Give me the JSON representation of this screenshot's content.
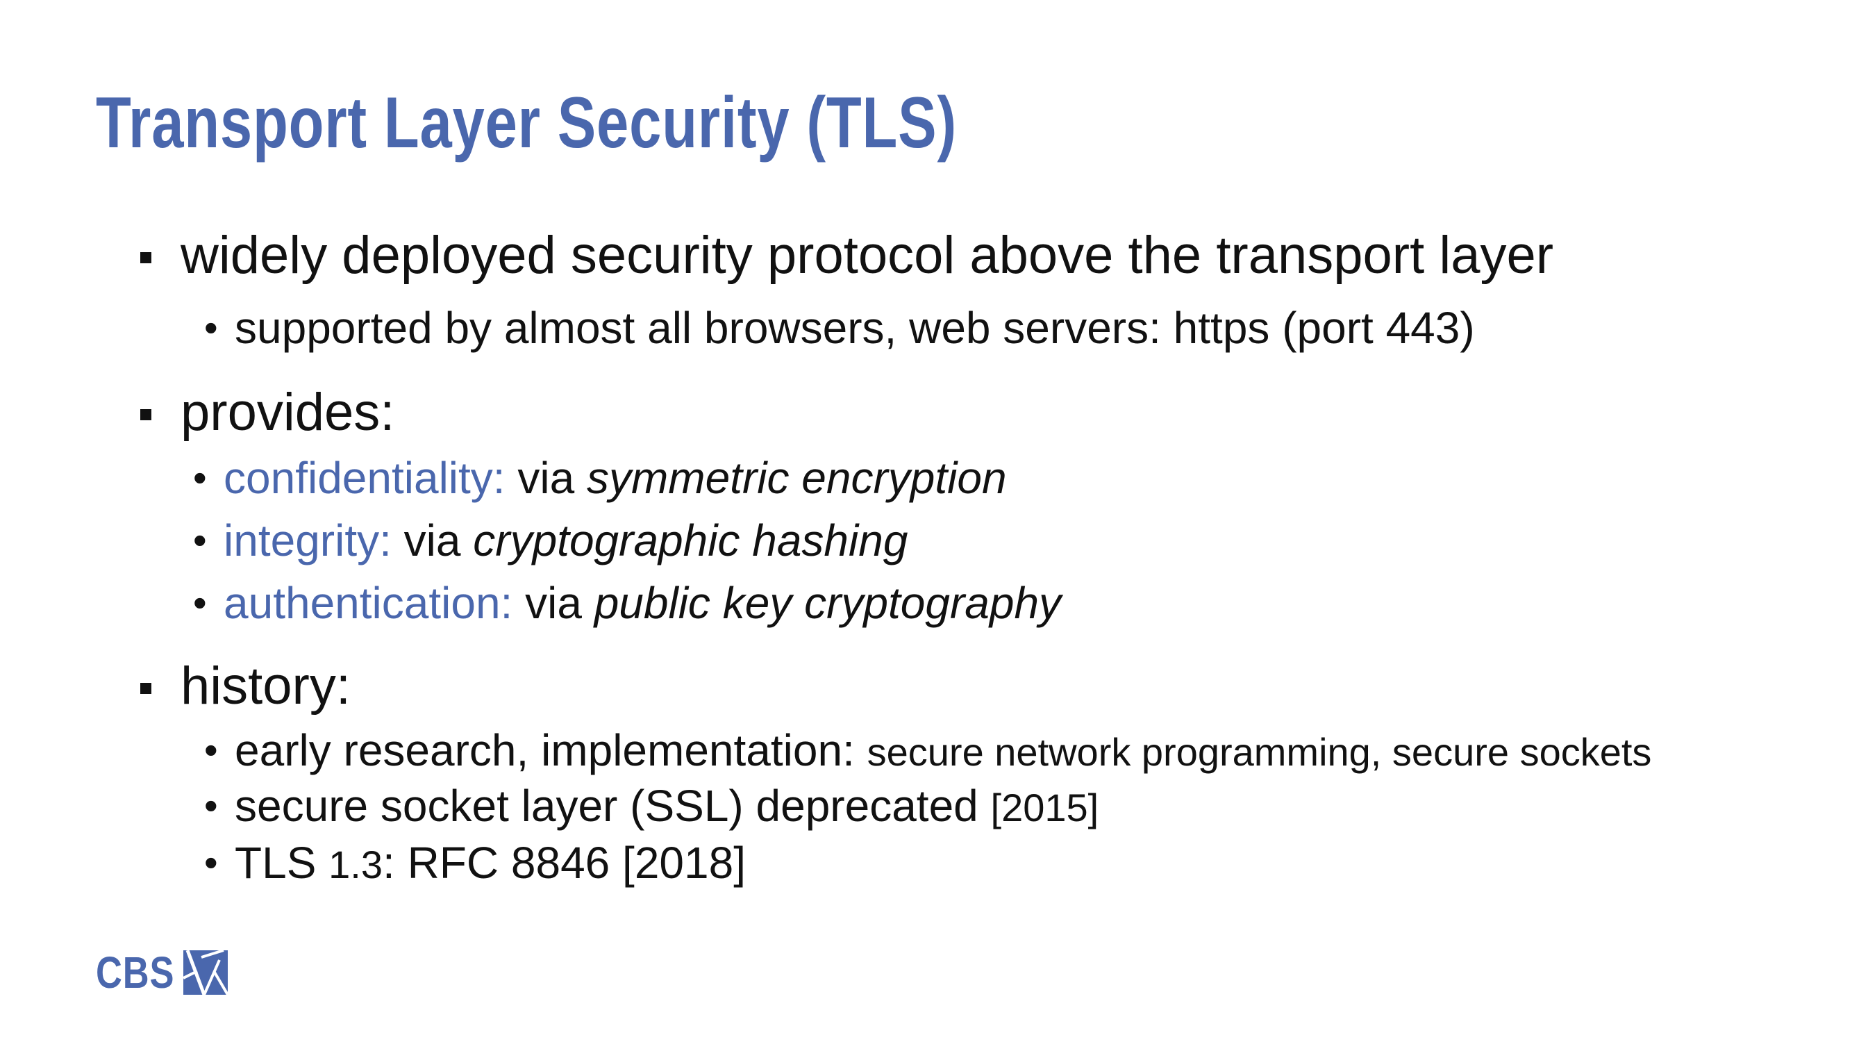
{
  "title": "Transport Layer Security (TLS)",
  "bullets": {
    "b1": {
      "text": "widely deployed security protocol above the transport layer",
      "sub1": "supported by almost all browsers, web servers: https (port 443)"
    },
    "b2": {
      "text": "provides:",
      "confidentiality": {
        "label": "confidentiality:",
        "via": " via ",
        "detail": "symmetric encryption"
      },
      "integrity": {
        "label": "integrity:",
        "via": " via ",
        "detail": "cryptographic hashing"
      },
      "authentication": {
        "label": "authentication:",
        "via": " via ",
        "detail": "public key cryptography"
      }
    },
    "b3": {
      "text": "history:",
      "early_prefix": "early research, implementation: ",
      "early_detail": "secure network programming, secure sockets",
      "ssl_prefix": "secure socket layer (SSL) deprecated ",
      "ssl_year": "[2015]",
      "tls_prefix": "TLS ",
      "tls_version": "1.3",
      "tls_suffix": ": RFC 8846 [2018]"
    }
  },
  "logo": {
    "text": "CBS",
    "icon": "cbs-emblem-icon"
  },
  "colors": {
    "accent": "#4a67ad",
    "text": "#111111"
  }
}
